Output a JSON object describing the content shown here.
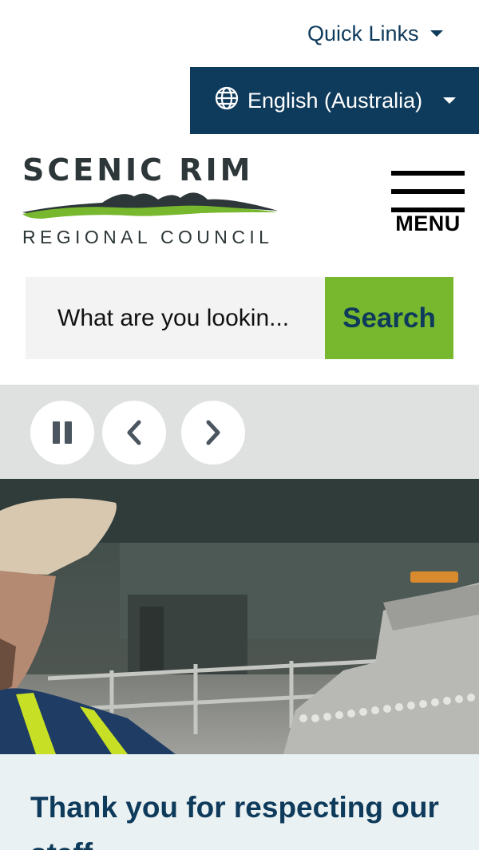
{
  "header": {
    "quick_links_label": "Quick Links",
    "language_label": "English (Australia)",
    "menu_label": "MENU"
  },
  "logo": {
    "line1": "SCENIC RIM",
    "line2": "REGIONAL COUNCIL"
  },
  "search": {
    "placeholder": "What are you lookin...",
    "button_label": "Search"
  },
  "carousel": {
    "slide_title": "Thank you for respecting our staff"
  },
  "colors": {
    "brand_navy": "#0e3a5b",
    "brand_green": "#77b82e",
    "search_bg": "#f3f3f3",
    "control_bar_bg": "#dfe1e1"
  }
}
